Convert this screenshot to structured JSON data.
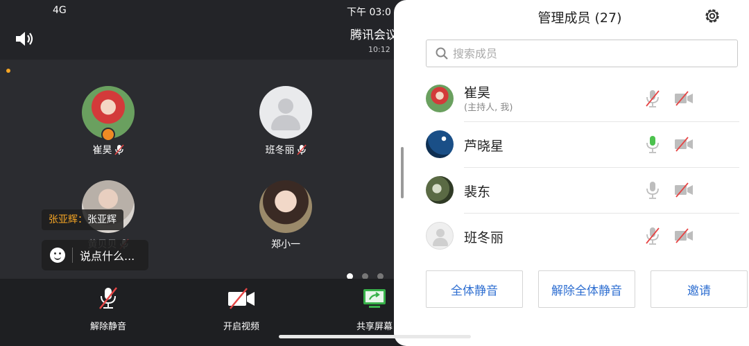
{
  "status": {
    "network": "4G",
    "time": "下午 03:0"
  },
  "meeting": {
    "title": "腾讯会议",
    "timer": "10:12",
    "participants": [
      {
        "name": "崔昊",
        "muted": true,
        "host": true
      },
      {
        "name": "班冬丽",
        "muted": true
      },
      {
        "name": "黄贝贝",
        "muted": true
      },
      {
        "name": "郑小一",
        "muted": false
      }
    ],
    "chat": {
      "sender": "张亚辉：",
      "message": "张亚辉",
      "placeholder": "说点什么..."
    },
    "page_dots": {
      "count": 3,
      "active": 0
    },
    "toolbar": {
      "unmute": "解除静音",
      "start_video": "开启视频",
      "share_screen": "共享屏幕"
    }
  },
  "panel": {
    "title": "管理成员 (27)",
    "search_placeholder": "搜索成员",
    "members": [
      {
        "name": "崔昊",
        "sub": "(主持人, 我)",
        "mic": "muted",
        "camera": "off"
      },
      {
        "name": "芦晓星",
        "sub": "",
        "mic": "speaking",
        "camera": "off"
      },
      {
        "name": "裴东",
        "sub": "",
        "mic": "on",
        "camera": "off"
      },
      {
        "name": "班冬丽",
        "sub": "",
        "mic": "muted",
        "camera": "off"
      }
    ],
    "buttons": {
      "mute_all": "全体静音",
      "unmute_all": "解除全体静音",
      "invite": "邀请"
    },
    "colors": {
      "accent": "#2f6fd1",
      "mic_active": "#4cc24e",
      "muted_red": "#e64545"
    }
  }
}
